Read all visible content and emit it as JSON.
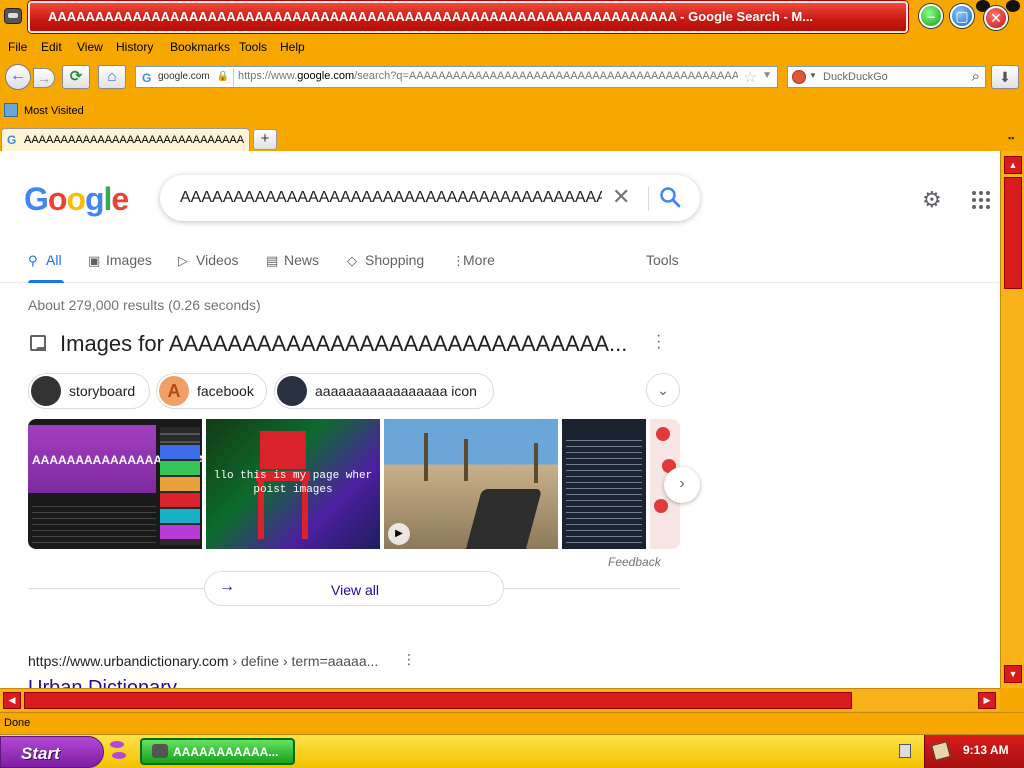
{
  "window": {
    "title": "AAAAAAAAAAAAAAAAAAAAAAAAAAAAAAAAAAAAAAAAAAAAAAAAAAAAAAAAAAAAAAAAAAA - Google Search - M..."
  },
  "menu": [
    "File",
    "Edit",
    "View",
    "History",
    "Bookmarks",
    "Tools",
    "Help"
  ],
  "nav": {
    "site_badge": "google.com",
    "url_prefix": "https://www.",
    "url_domain": "google.com",
    "url_rest": "/search?q=AAAAAAAAAAAAAAAAAAAAAAAAAAAAAAAAAAAAAAAAAAAAAAAAA",
    "search_engine": "DuckDuckGo"
  },
  "bookmarks": {
    "most_visited": "Most Visited"
  },
  "tabs": [
    {
      "title": "AAAAAAAAAAAAAAAAAAAAAAAAAAAAAAAAAAA..."
    }
  ],
  "google": {
    "logo": [
      "G",
      "o",
      "o",
      "g",
      "l",
      "e"
    ],
    "query": "AAAAAAAAAAAAAAAAAAAAAAAAAAAAAAAAAAAAAAAAAAAAAAAAAAAAA",
    "search_tabs": [
      "All",
      "Images",
      "Videos",
      "News",
      "Shopping",
      "More"
    ],
    "tools": "Tools",
    "stats": "About 279,000 results (0.26 seconds)",
    "images_heading": "Images for AAAAAAAAAAAAAAAAAAAAAAAAAAAAAA...",
    "chips": [
      "storyboard",
      "facebook",
      "aaaaaaaaaaaaaaaaa icon"
    ],
    "chip_letter": "A",
    "image1_text": "AAAAAAAAAAAAAAAAAAAA",
    "image2_text_1": "llo this is my page wher",
    "image2_text_2": "poist images",
    "feedback": "Feedback",
    "view_all": "View all",
    "result": {
      "domain": "https://www.urbandictionary.com",
      "path": " › define › term=aaaaa...",
      "title": "Urban Dictionary"
    }
  },
  "status": "Done",
  "taskbar": {
    "start": "Start",
    "item": "AAAAAAAAAAA...",
    "time": "9:13 AM"
  },
  "colors": {
    "chrome": "#f7a800",
    "title_red": "#c71912",
    "google_blue": "#1a73e8",
    "link": "#1a0dab"
  }
}
